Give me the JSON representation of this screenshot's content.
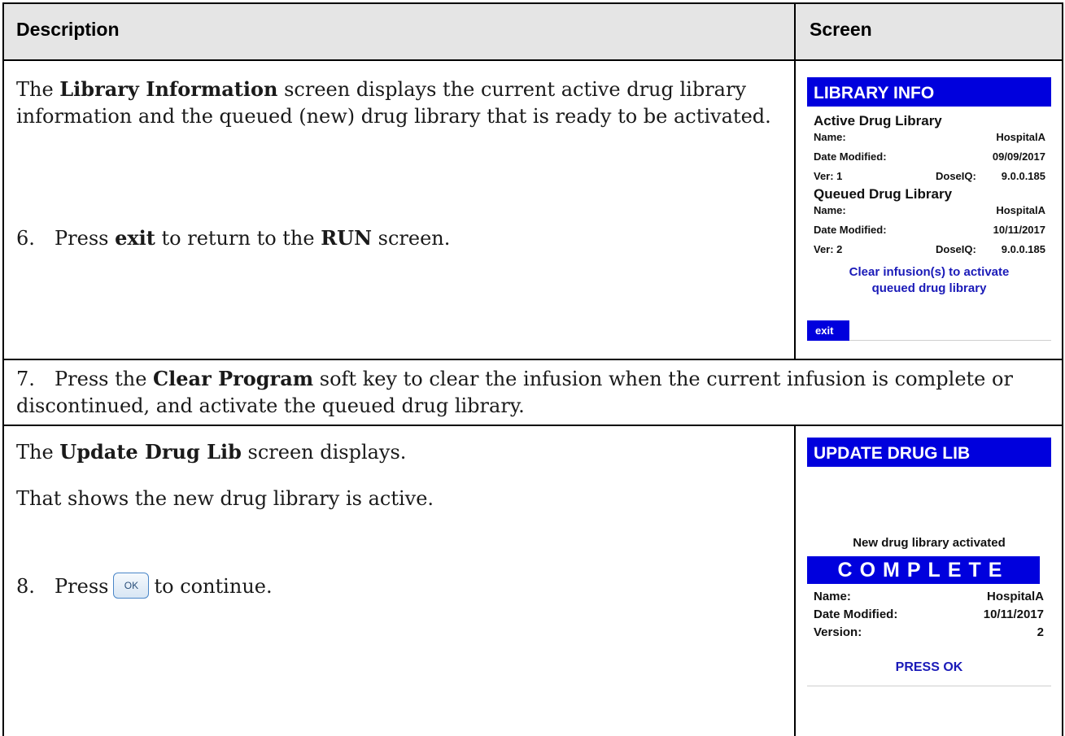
{
  "header": {
    "description": "Description",
    "screen": "Screen"
  },
  "row1": {
    "para_lead": "The ",
    "para_bold": "Library Information",
    "para_rest": " screen displays the current active drug library information and the queued (new) drug library that is ready to be activated.",
    "step_num": "6.",
    "step_a": "Press ",
    "step_b": "exit",
    "step_c": " to return to the ",
    "step_d": "RUN",
    "step_e": " screen."
  },
  "row2": {
    "step_num": "7.",
    "a": "Press the ",
    "b": "Clear Program",
    "c": " soft key to clear the infusion when the current infusion is complete or discontinued, and activate the queued drug library."
  },
  "row3": {
    "p1_a": "The ",
    "p1_b": "Update Drug Lib",
    "p1_c": " screen displays.",
    "p2": "That shows the new drug library is active.",
    "step_num": "8.",
    "step_a": "Press",
    "ok": "OK",
    "step_c": "to continue."
  },
  "screen1": {
    "title": "LIBRARY INFO",
    "active_heading": "Active Drug Library",
    "name_label": "Name:",
    "active_name": "HospitalA",
    "date_label": "Date Modified:",
    "active_date": "09/09/2017",
    "active_ver": "Ver:  1",
    "doseiq_label": "DoseIQ:",
    "active_doseiq": "9.0.0.185",
    "queued_heading": "Queued Drug Library",
    "queued_name": "HospitalA",
    "queued_date": "10/11/2017",
    "queued_ver": "Ver:  2",
    "queued_doseiq": "9.0.0.185",
    "message_line1": "Clear infusion(s) to activate",
    "message_line2": "queued drug library",
    "exit": "exit"
  },
  "screen2": {
    "title": "UPDATE DRUG LIB",
    "activated": "New drug library activated",
    "complete": "COMPLETE",
    "name_label": "Name:",
    "name": "HospitalA",
    "date_label": "Date Modified:",
    "date": "10/11/2017",
    "version_label": "Version:",
    "version": "2",
    "press_ok": "PRESS OK"
  },
  "colors": {
    "screen_blue": "#0000dd",
    "header_gray": "#e5e5e5",
    "message_blue": "#1a1ab8"
  }
}
